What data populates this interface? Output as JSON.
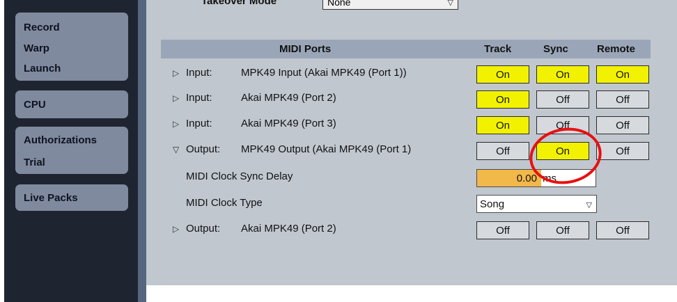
{
  "sidebar": {
    "groups": [
      {
        "items": [
          "Record",
          "Warp",
          "Launch"
        ]
      },
      {
        "items": [
          "CPU"
        ]
      },
      {
        "items": [
          "Authorizations",
          "Trial"
        ]
      },
      {
        "items": [
          "Live Packs"
        ]
      }
    ]
  },
  "takeover": {
    "label": "Takeover Mode",
    "value": "None"
  },
  "midi_ports": {
    "header": {
      "title": "MIDI Ports",
      "track": "Track",
      "sync": "Sync",
      "remote": "Remote"
    },
    "rows": [
      {
        "type": "Input:",
        "name": "MPK49 Input (Akai MPK49 (Port 1))",
        "track": "On",
        "sync": "On",
        "remote": "On"
      },
      {
        "type": "Input:",
        "name": "Akai MPK49 (Port 2)",
        "track": "On",
        "sync": "Off",
        "remote": "Off"
      },
      {
        "type": "Input:",
        "name": "Akai MPK49 (Port 3)",
        "track": "On",
        "sync": "Off",
        "remote": "Off"
      },
      {
        "type": "Output:",
        "name": "MPK49 Output (Akai MPK49 (Port 1)",
        "track": "Off",
        "sync": "On",
        "remote": "Off"
      },
      {
        "type": "Output:",
        "name": "Akai MPK49 (Port 2)",
        "track": "Off",
        "sync": "Off",
        "remote": "Off"
      }
    ],
    "expanded_triangle": "▽",
    "collapsed_triangle": "▷"
  },
  "clock_sync_delay": {
    "label": "MIDI Clock Sync Delay",
    "value": "0.00",
    "unit": "ms"
  },
  "clock_type": {
    "label": "MIDI Clock Type",
    "value": "Song"
  },
  "colors": {
    "on": "#f2f200",
    "off": "#d6d9dd",
    "annotation": "#e81010",
    "delay_fill": "#f2b84a"
  }
}
